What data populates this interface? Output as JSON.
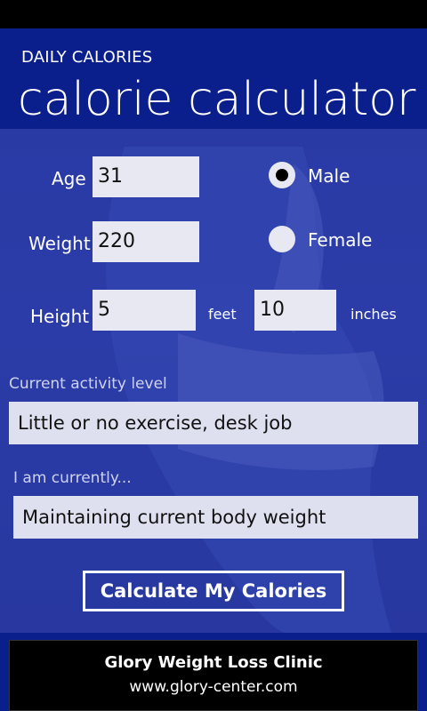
{
  "header": {
    "app_title": "DAILY CALORIES",
    "page_title": "calorie calculator"
  },
  "form": {
    "age_label": "Age",
    "age_value": "31",
    "weight_label": "Weight",
    "weight_value": "220",
    "height_label": "Height",
    "height_feet_value": "5",
    "feet_unit": "feet",
    "height_inches_value": "10",
    "inches_unit": "inches",
    "gender": {
      "male_label": "Male",
      "female_label": "Female",
      "selected": "Male"
    },
    "activity_caption": "Current activity level",
    "activity_value": "Little or no exercise, desk job",
    "goal_caption": "I am currently...",
    "goal_value": "Maintaining current body weight",
    "calculate_label": "Calculate My Calories"
  },
  "ad": {
    "title": "Glory Weight Loss Clinic",
    "url": "www.glory-center.com"
  },
  "colors": {
    "header_bg": "#0b1f8c",
    "content_bg": "#2b3ca8",
    "field_bg": "#e8e8f2"
  }
}
